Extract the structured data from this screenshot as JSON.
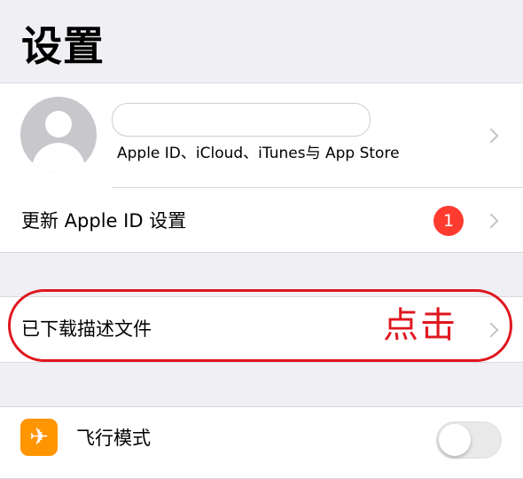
{
  "page": {
    "title": "设置"
  },
  "account": {
    "subtitle": "Apple ID、iCloud、iTunes与 App Store",
    "update_row_label": "更新 Apple ID 设置",
    "update_badge_count": "1"
  },
  "profile_row": {
    "label": "已下载描述文件"
  },
  "annotation": {
    "label": "点击",
    "color": "#e0161e"
  },
  "network": {
    "airplane_label": "飞行模式",
    "airplane_on": false
  },
  "colors": {
    "badge": "#ff3b30",
    "airplane_icon_bg": "#ff9500",
    "background": "#efeff4"
  },
  "icons": {
    "avatar": "person-avatar-icon",
    "airplane": "airplane-icon",
    "chevron": "chevron-right-icon"
  }
}
